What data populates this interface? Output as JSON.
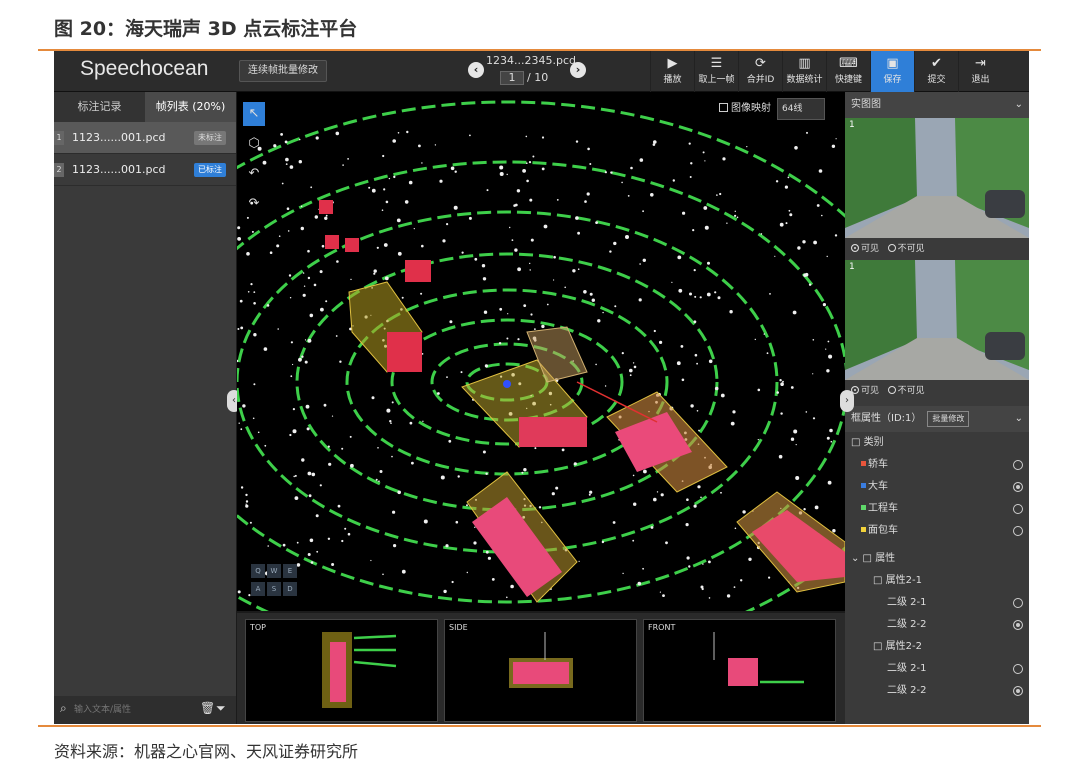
{
  "figure": {
    "title": "图 20：海天瑞声 3D 点云标注平台",
    "source": "资料来源：机器之心官网、天风证券研究所"
  },
  "app": {
    "logo": "Speechocean",
    "batch_button": "连续帧批量修改",
    "file_nav": {
      "filename": "1234...2345.pcd",
      "page_current": "1",
      "page_total": "/ 10"
    },
    "toolbar": [
      {
        "icon": "play-icon",
        "label": "播放"
      },
      {
        "icon": "previous-frame-icon",
        "label": "取上一帧"
      },
      {
        "icon": "merge-id-icon",
        "label": "合并ID"
      },
      {
        "icon": "stats-icon",
        "label": "数据统计"
      },
      {
        "icon": "keyboard-icon",
        "label": "快捷键"
      },
      {
        "icon": "save-icon",
        "label": "保存"
      },
      {
        "icon": "submit-icon",
        "label": "提交"
      },
      {
        "icon": "exit-icon",
        "label": "退出"
      }
    ],
    "left_panel": {
      "tabs": [
        "标注记录",
        "帧列表 (20%)"
      ],
      "files": [
        {
          "num": "1",
          "name": "1123......001.pcd",
          "status": "未标注"
        },
        {
          "num": "2",
          "name": "1123......001.pcd",
          "status": "已标注"
        }
      ],
      "search_placeholder": "输入文本/属性"
    },
    "viewport": {
      "image_mapping_label": "图像映射",
      "beam_select": "64线",
      "keys": [
        "Q",
        "W",
        "E",
        "A",
        "S",
        "D"
      ],
      "subviews": [
        "TOP",
        "SIDE",
        "FRONT"
      ]
    },
    "right_panel": {
      "image_header": "实图图",
      "images": [
        {
          "num": "1",
          "visible": "可见",
          "invisible": "不可见"
        },
        {
          "num": "1",
          "visible": "可见",
          "invisible": "不可见"
        }
      ],
      "attr_header": "框属性（ID:1）",
      "attr_badge": "批量修改",
      "category_label": "类别",
      "categories": [
        {
          "label": "轿车",
          "color": "#e8553b",
          "selected": false
        },
        {
          "label": "大车",
          "color": "#3a7de0",
          "selected": true
        },
        {
          "label": "工程车",
          "color": "#5fd86a",
          "selected": false
        },
        {
          "label": "面包车",
          "color": "#f2d23a",
          "selected": false
        }
      ],
      "attribute_label": "属性",
      "attr_groups": [
        {
          "name": "属性2-1",
          "items": [
            {
              "label": "二级 2-1",
              "selected": false
            },
            {
              "label": "二级 2-2",
              "selected": true
            }
          ]
        },
        {
          "name": "属性2-2",
          "items": [
            {
              "label": "二级 2-1",
              "selected": false
            },
            {
              "label": "二级 2-2",
              "selected": true
            }
          ]
        }
      ]
    }
  }
}
